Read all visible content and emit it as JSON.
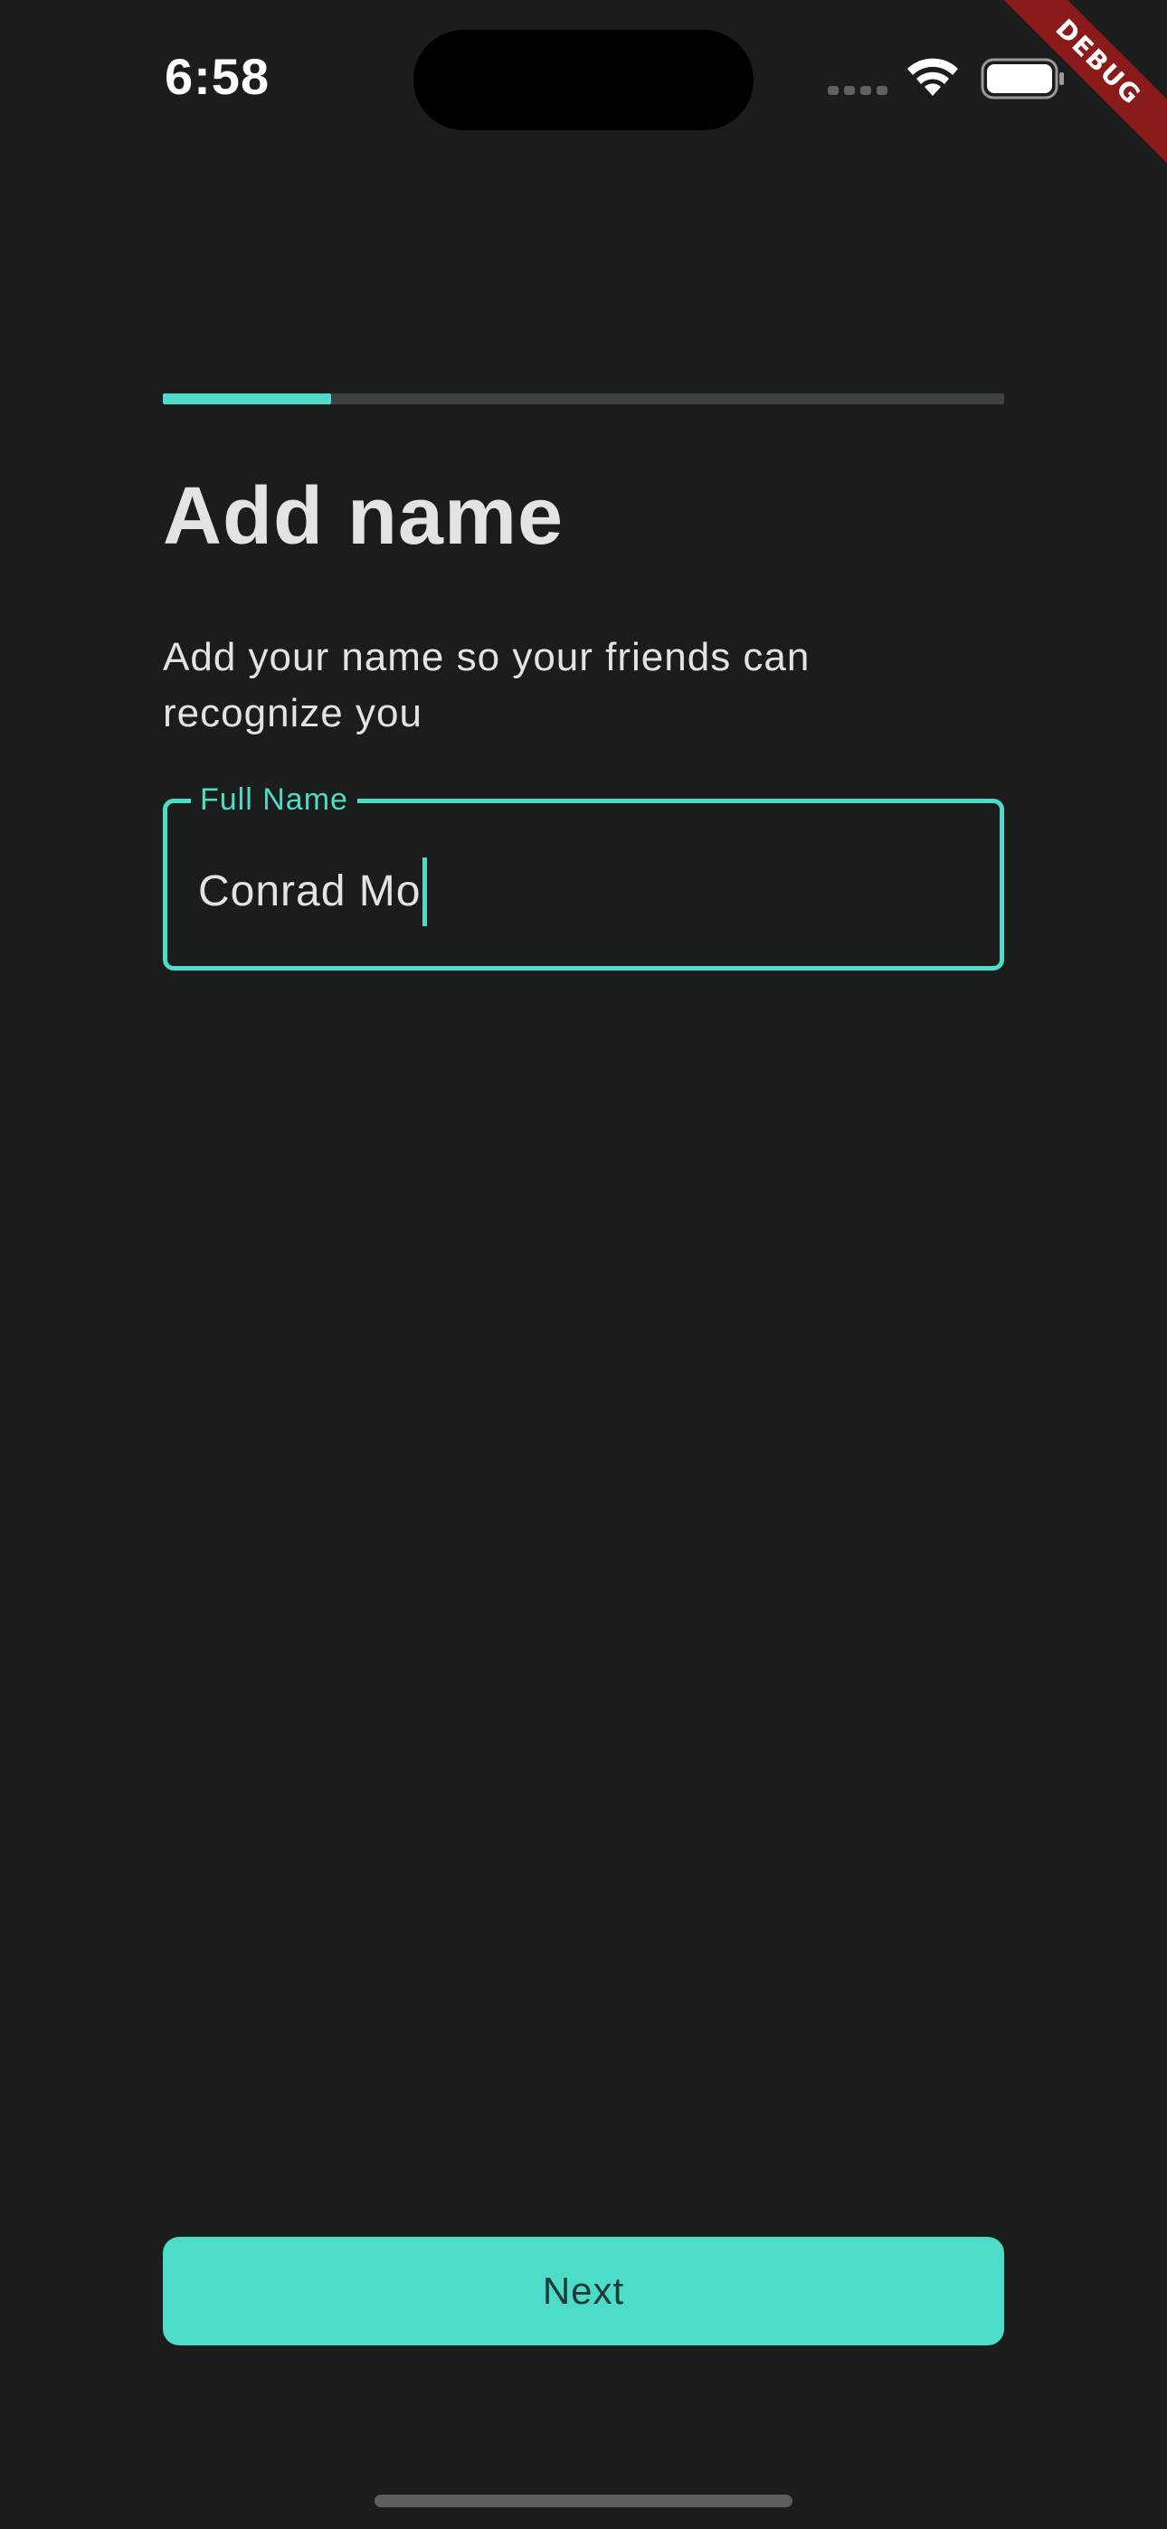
{
  "status_bar": {
    "time": "6:58"
  },
  "debug_banner": {
    "label": "DEBUG"
  },
  "progress": {
    "fraction": 0.2
  },
  "title": "Add name",
  "subtitle": "Add your name so your friends can recognize you",
  "name_field": {
    "label": "Full Name",
    "value": "Conrad Mo"
  },
  "next_button": {
    "label": "Next"
  },
  "colors": {
    "background": "#1b1c1c",
    "accent": "#4ddcc8",
    "track": "#3d4342",
    "button_text": "#1e3a37"
  }
}
